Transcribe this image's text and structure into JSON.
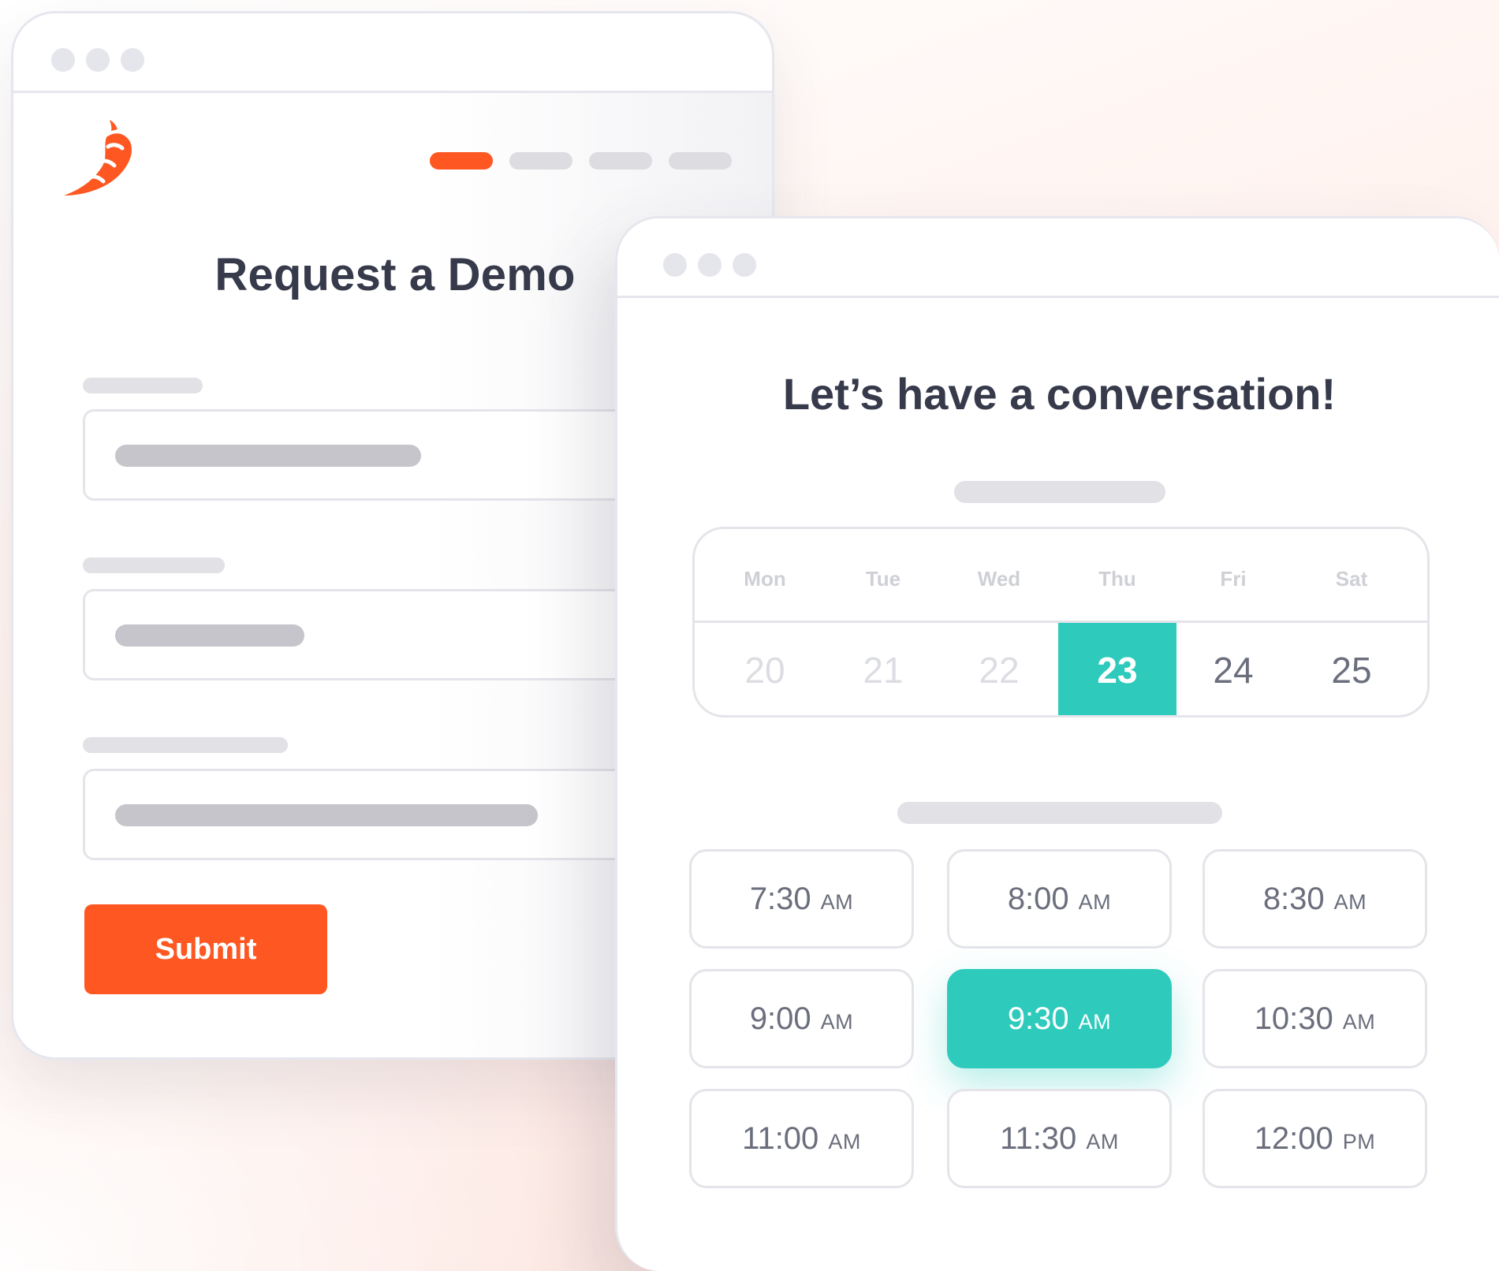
{
  "form_window": {
    "title": "Request a Demo",
    "submit_label": "Submit",
    "progress_steps": 4,
    "active_step": 1
  },
  "scheduler_window": {
    "title": "Let’s have a conversation!",
    "calendar": {
      "days": [
        {
          "name": "Mon",
          "date": "20",
          "state": "past"
        },
        {
          "name": "Tue",
          "date": "21",
          "state": "past"
        },
        {
          "name": "Wed",
          "date": "22",
          "state": "past"
        },
        {
          "name": "Thu",
          "date": "23",
          "state": "selected"
        },
        {
          "name": "Fri",
          "date": "24",
          "state": "available"
        },
        {
          "name": "Sat",
          "date": "25",
          "state": "available"
        }
      ]
    },
    "time_slots": [
      {
        "time": "7:30",
        "period": "AM",
        "selected": false
      },
      {
        "time": "8:00",
        "period": "AM",
        "selected": false
      },
      {
        "time": "8:30",
        "period": "AM",
        "selected": false
      },
      {
        "time": "9:00",
        "period": "AM",
        "selected": false
      },
      {
        "time": "9:30",
        "period": "AM",
        "selected": true
      },
      {
        "time": "10:30",
        "period": "AM",
        "selected": false
      },
      {
        "time": "11:00",
        "period": "AM",
        "selected": false
      },
      {
        "time": "11:30",
        "period": "AM",
        "selected": false
      },
      {
        "time": "12:00",
        "period": "PM",
        "selected": false
      }
    ]
  },
  "colors": {
    "brand_orange": "#ff5722",
    "selection_teal": "#2ecbbd",
    "heading_text": "#363a4a"
  },
  "icons": {
    "logo": "chili-pepper-logo-icon"
  }
}
